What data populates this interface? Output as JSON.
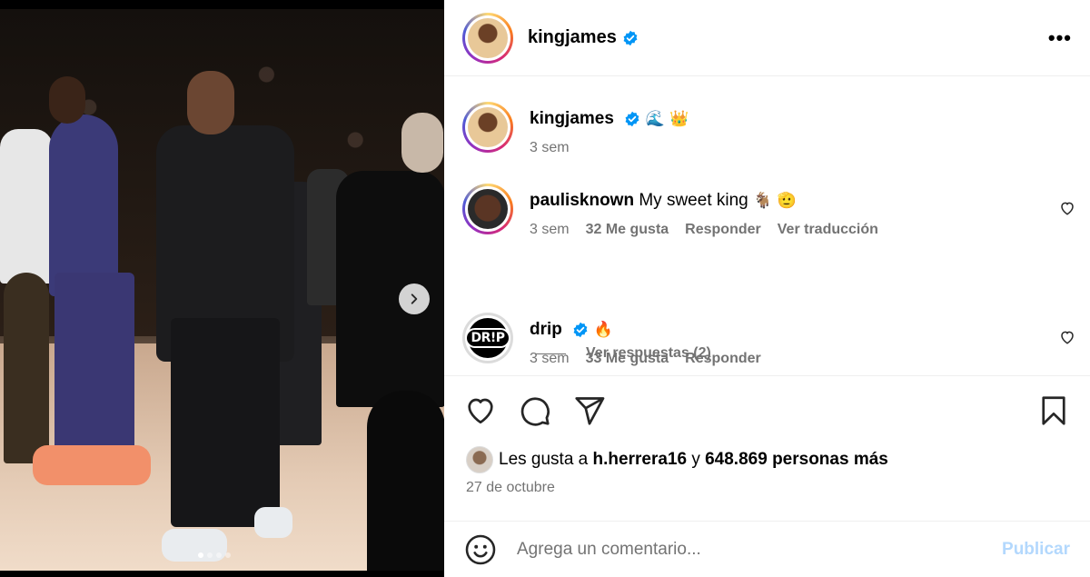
{
  "post": {
    "carousel": {
      "next_icon": "chevron-right-icon",
      "dots_count": 4,
      "active_dot": 0
    }
  },
  "header": {
    "username": "kingjames",
    "verified": true,
    "more_icon": "more-horizontal-icon",
    "more_label": "•••"
  },
  "caption": {
    "username": "kingjames",
    "emojis": "🌊 👑",
    "time": "3 sem"
  },
  "comments": [
    {
      "username": "paulisknown",
      "text": "My sweet king",
      "emojis": "🐐 🫡",
      "time": "3 sem",
      "likes": "32 Me gusta",
      "reply": "Responder",
      "translate": "Ver traducción"
    },
    {
      "username": "drip",
      "verified": true,
      "emojis": "🔥",
      "time": "3 sem",
      "likes": "33 Me gusta",
      "reply": "Responder",
      "avatar_text": "DR!P"
    }
  ],
  "replies_toggle": "Ver respuestas (2)",
  "actions": {
    "like_icon": "heart-icon",
    "comment_icon": "comment-icon",
    "share_icon": "send-icon",
    "save_icon": "bookmark-icon"
  },
  "likes": {
    "prefix": "Les gusta a",
    "user": "h.herrera16",
    "joiner": "y",
    "count": "648.869 personas más"
  },
  "date": "27 de octubre",
  "add_comment": {
    "emoji_icon": "smile-icon",
    "placeholder": "Agrega un comentario...",
    "publish": "Publicar"
  },
  "colors": {
    "verified": "#0095f6",
    "muted": "#737373",
    "publish_disabled": "#b3d8fd"
  }
}
